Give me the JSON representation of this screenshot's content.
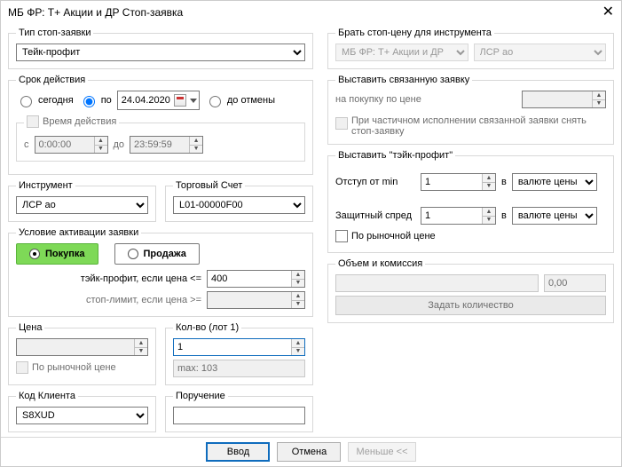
{
  "title": "МБ ФР: T+ Акции и ДР Стоп-заявка",
  "left": {
    "group_type": "Тип стоп-заявки",
    "type_value": "Тейк-профит",
    "group_validity": "Срок действия",
    "today": "сегодня",
    "until": "по",
    "date": "24.04.2020",
    "gtc": "до отмены",
    "group_time": "Время действия",
    "from_lbl": "c",
    "from_val": "0:00:00",
    "to_lbl": "до",
    "to_val": "23:59:59",
    "group_instr": "Инструмент",
    "instr_val": "ЛСР ао",
    "group_acct": "Торговый Счет",
    "acct_val": "L01-00000F00",
    "group_cond": "Условие активации заявки",
    "buy": "Покупка",
    "sell": "Продажа",
    "tp_cond": "тэйк-профит, если цена <=",
    "tp_val": "400",
    "sl_cond": "стоп-лимит, если цена >=",
    "group_price": "Цена",
    "market": "По рыночной цене",
    "group_qty": "Кол-во (лот 1)",
    "qty_val": "1",
    "max_qty": "max: 103",
    "group_client": "Код Клиента",
    "client_val": "S8XUD",
    "group_order": "Поручение"
  },
  "right": {
    "group_src": "Брать стоп-цену для инструмента",
    "src_board": "МБ ФР: T+ Акции и ДР",
    "src_instr": "ЛСР ао",
    "group_linked": "Выставить связанную заявку",
    "linked_lbl": "на покупку по цене",
    "linked_chk": "При частичном исполнении связанной заявки снять стоп-заявку",
    "group_tp": "Выставить \"тэйк-профит\"",
    "offset_lbl": "Отступ от min",
    "offset_val": "1",
    "in": "в",
    "unit": "валюте цены",
    "spread_lbl": "Защитный спред",
    "spread_val": "1",
    "market": "По рыночной цене",
    "group_vol": "Объем и комиссия",
    "commission": "0,00",
    "set_qty": "Задать количество",
    "ok": "Ввод",
    "cancel": "Отмена",
    "less": "Меньше <<"
  }
}
